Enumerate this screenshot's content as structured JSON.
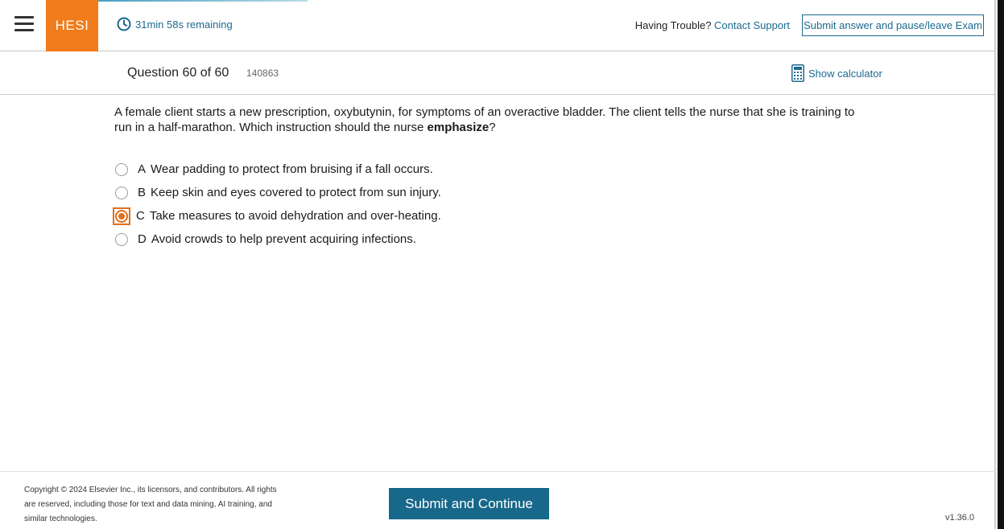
{
  "header": {
    "brand": "HESI",
    "timer_text": "31min 58s remaining",
    "trouble_text": "Having Trouble?",
    "contact_link": "Contact Support",
    "pause_button": "Submit answer and pause/leave Exam"
  },
  "question_bar": {
    "title": "Question 60 of 60",
    "id": "140863",
    "calculator": "Show calculator"
  },
  "question": {
    "stem_part1": "A female client starts a new prescription, oxybutynin, for symptoms of an overactive bladder. The client tells the nurse that she is training to run in a half-marathon. Which instruction should the nurse ",
    "stem_emphasis": "emphasize",
    "stem_end": "?",
    "options": [
      {
        "letter": "A",
        "text": "Wear padding to protect from bruising if a fall occurs.",
        "selected": false
      },
      {
        "letter": "B",
        "text": "Keep skin and eyes covered to protect from sun injury.",
        "selected": false
      },
      {
        "letter": "C",
        "text": "Take measures to avoid dehydration and over-heating.",
        "selected": true
      },
      {
        "letter": "D",
        "text": "Avoid crowds to help prevent acquiring infections.",
        "selected": false
      }
    ]
  },
  "footer": {
    "copyright": "Copyright © 2024 Elsevier Inc., its licensors, and contributors. All rights are reserved, including those for text and data mining, AI training, and similar technologies.",
    "submit_button": "Submit and Continue",
    "version": "v1.36.0"
  },
  "colors": {
    "brand": "#f07c1b",
    "accent": "#1c6a8f",
    "selected": "#e0701a",
    "submit_bg": "#17688a"
  }
}
